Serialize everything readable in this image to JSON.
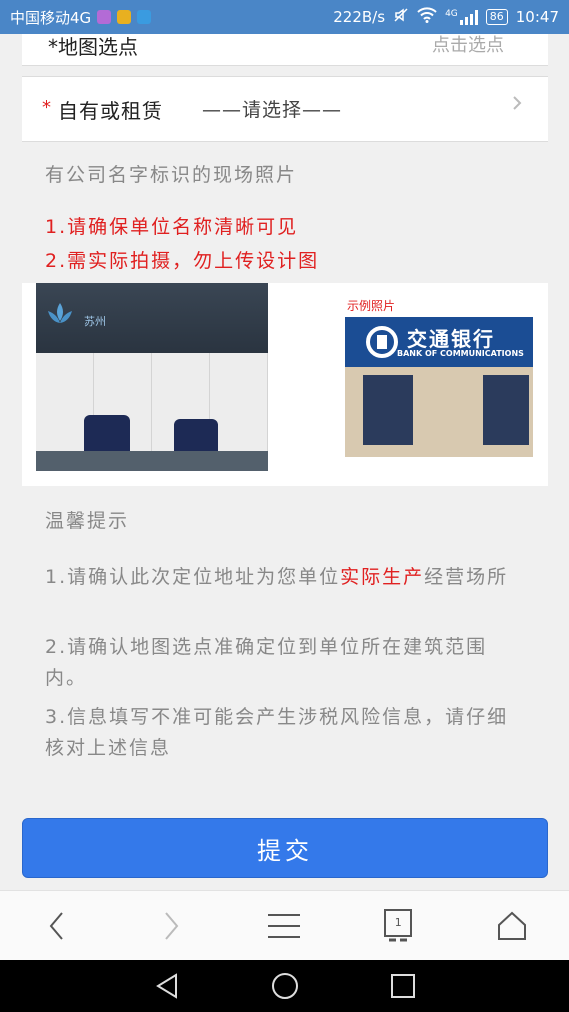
{
  "statusbar": {
    "carrier": "中国移动4G",
    "speed": "222B/s",
    "network": "4G",
    "battery": "86",
    "time": "10:47"
  },
  "form": {
    "clipped_row": {
      "label": "*地图选点",
      "value": "点击选点"
    },
    "ownership_row": {
      "required_mark": "*",
      "label": "自有或租赁",
      "value": "——请选择——"
    },
    "photo_section": {
      "title": "有公司名字标识的现场照片",
      "tip1": "1.请确保单位名称清晰可见",
      "tip2": "2.需实际拍摄，勿上传设计图",
      "uploaded_banner_text": "苏州",
      "example_caption": "示例照片",
      "example_bank_cn": "交通银行",
      "example_bank_en": "BANK OF COMMUNICATIONS"
    },
    "notice": {
      "title": "温馨提示",
      "item1_a": "1.请确认此次定位地址为您单位",
      "item1_hl": "实际生产",
      "item1_b": "经营场所",
      "item2": "2.请确认地图选点准确定位到单位所在建筑范围内。",
      "item3": "3.信息填写不准可能会产生涉税风险信息，请仔细核对上述信息"
    },
    "submit_label": "提交"
  },
  "browser": {
    "tab_count": "1"
  },
  "colors": {
    "accent": "#3479ea",
    "required": "#e02020",
    "statusbar": "#4a86c7"
  }
}
